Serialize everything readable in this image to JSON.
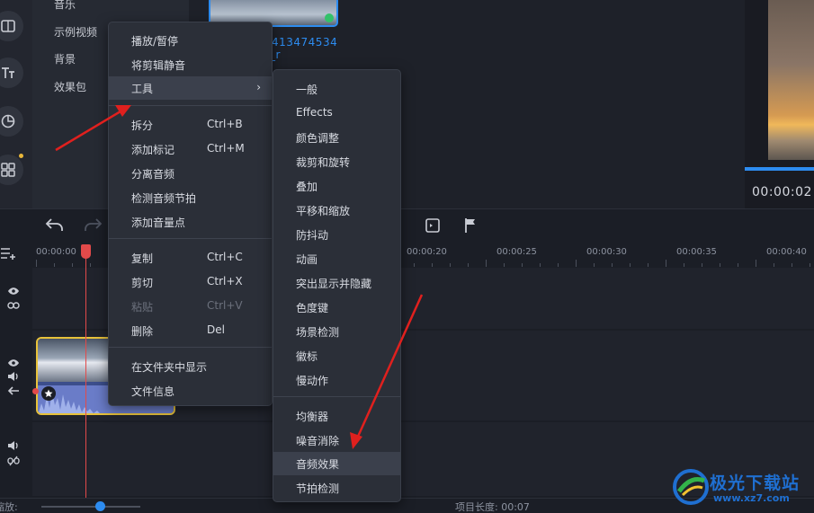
{
  "library": {
    "items": [
      "音乐",
      "示例视频",
      "背景",
      "效果包"
    ]
  },
  "media": {
    "clip_name_line1": "413474534",
    "clip_name_line2": "_r"
  },
  "preview": {
    "time": "00:00:02"
  },
  "ruler": {
    "labels": [
      "00:00:00",
      "00:00:20",
      "00:00:25",
      "00:00:30",
      "00:00:35",
      "00:00:40"
    ]
  },
  "context_menu": {
    "items": [
      {
        "label": "播放/暂停",
        "shortcut": ""
      },
      {
        "label": "将剪辑静音",
        "shortcut": ""
      },
      {
        "label": "工具",
        "shortcut": "",
        "submenu": true
      },
      {
        "label": "拆分",
        "shortcut": "Ctrl+B"
      },
      {
        "label": "添加标记",
        "shortcut": "Ctrl+M"
      },
      {
        "label": "分离音频",
        "shortcut": ""
      },
      {
        "label": "检测音频节拍",
        "shortcut": ""
      },
      {
        "label": "添加音量点",
        "shortcut": ""
      },
      {
        "label": "复制",
        "shortcut": "Ctrl+C"
      },
      {
        "label": "剪切",
        "shortcut": "Ctrl+X"
      },
      {
        "label": "粘贴",
        "shortcut": "Ctrl+V",
        "disabled": true
      },
      {
        "label": "删除",
        "shortcut": "Del"
      },
      {
        "label": "在文件夹中显示",
        "shortcut": ""
      },
      {
        "label": "文件信息",
        "shortcut": ""
      }
    ]
  },
  "tools_submenu": {
    "items": [
      "一般",
      "Effects",
      "颜色调整",
      "裁剪和旋转",
      "叠加",
      "平移和缩放",
      "防抖动",
      "动画",
      "突出显示并隐藏",
      "色度键",
      "场景检测",
      "徽标",
      "慢动作",
      "均衡器",
      "噪音消除",
      "音频效果",
      "节拍检测"
    ]
  },
  "status": {
    "left": "缩放:",
    "project_length": "项目长度: 00:07"
  },
  "watermark": {
    "name": "极光下载站",
    "url": "www.xz7.com"
  },
  "colors": {
    "accent": "#2d8cf0",
    "playhead": "#e24a4a",
    "clip_border": "#e8c23a",
    "annotation_arrow": "#e0201e"
  }
}
